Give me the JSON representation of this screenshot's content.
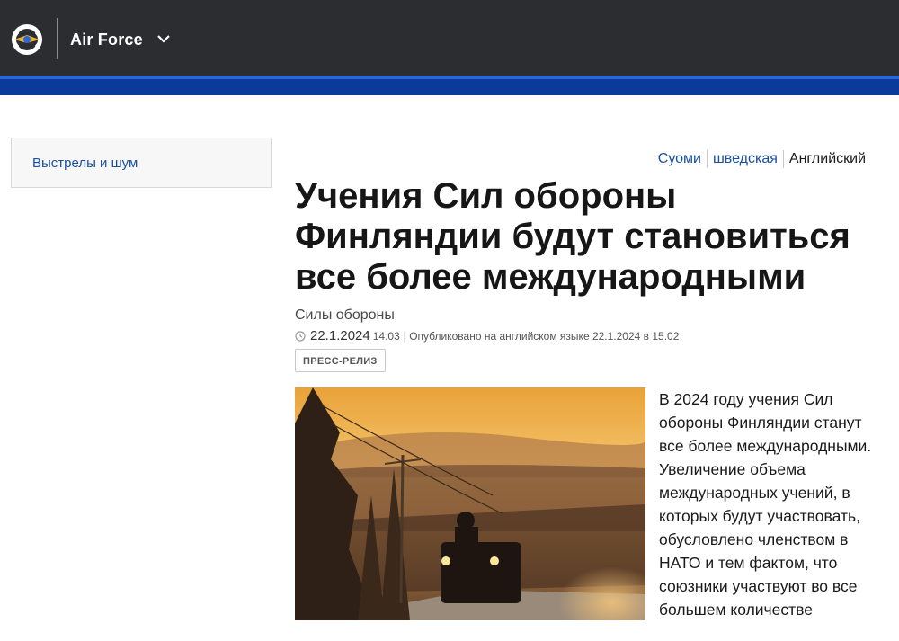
{
  "header": {
    "brand": "Air Force",
    "logo_icon": "air-force-emblem-icon",
    "menu_icon": "chevron-down-icon"
  },
  "sidebar": {
    "items": [
      {
        "label": "Выстрелы и шум"
      }
    ]
  },
  "languages": [
    {
      "label": "Суоми",
      "active": false
    },
    {
      "label": "шведская",
      "active": false
    },
    {
      "label": "Английский",
      "active": true
    }
  ],
  "article": {
    "title": "Учения Сил обороны Финляндии будут становиться все более международными",
    "category": "Силы обороны",
    "date": "22.1.2024",
    "time": "14.03",
    "published_note": "| Опубликовано на английском языке 22.1.2024 в 15.02",
    "badge": "ПРЕСС-РЕЛИЗ",
    "body": "В 2024 году учения Сил обороны Финляндии станут все более международными. Увеличение объема международных учений, в которых будут участвовать, обусловлено членством в НАТО и тем фактом, что союзники участвуют во все большем количестве"
  },
  "colors": {
    "header_bg": "#2b2d30",
    "brand_blue": "#0a3a9a",
    "link": "#1a4fa3"
  }
}
